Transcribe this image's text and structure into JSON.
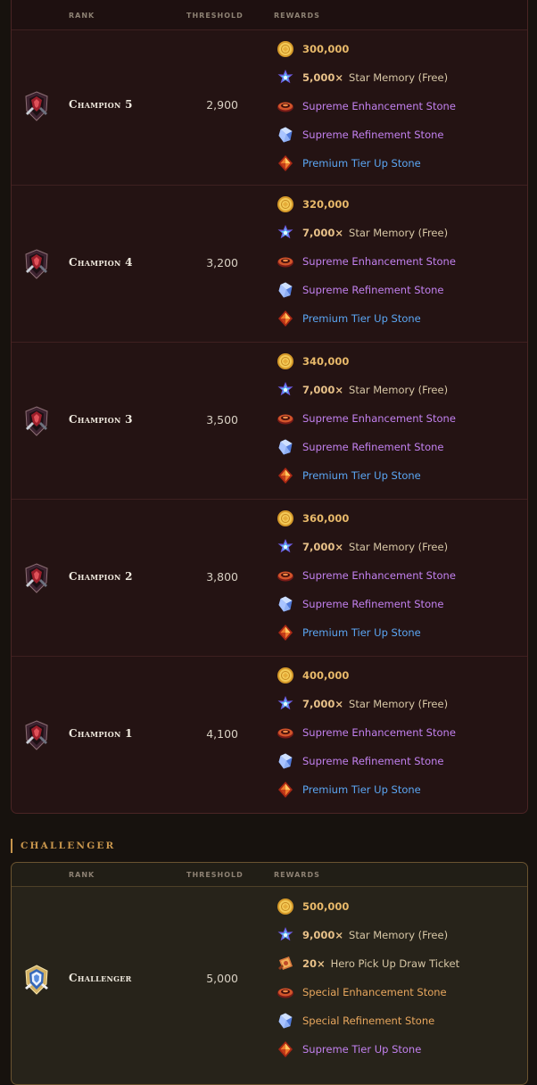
{
  "table_headers": {
    "rank": "RANK",
    "threshold": "THRESHOLD",
    "rewards": "REWARDS"
  },
  "champion_rows": [
    {
      "rank": "Champion 5",
      "threshold": "2,900",
      "gold": "300,000",
      "star_qty": "5,000×",
      "star_label": "Star Memory (Free)",
      "enhance": "Supreme Enhancement Stone",
      "refine": "Supreme Refinement Stone",
      "tier": "Premium Tier Up Stone"
    },
    {
      "rank": "Champion 4",
      "threshold": "3,200",
      "gold": "320,000",
      "star_qty": "7,000×",
      "star_label": "Star Memory (Free)",
      "enhance": "Supreme Enhancement Stone",
      "refine": "Supreme Refinement Stone",
      "tier": "Premium Tier Up Stone"
    },
    {
      "rank": "Champion 3",
      "threshold": "3,500",
      "gold": "340,000",
      "star_qty": "7,000×",
      "star_label": "Star Memory (Free)",
      "enhance": "Supreme Enhancement Stone",
      "refine": "Supreme Refinement Stone",
      "tier": "Premium Tier Up Stone"
    },
    {
      "rank": "Champion 2",
      "threshold": "3,800",
      "gold": "360,000",
      "star_qty": "7,000×",
      "star_label": "Star Memory (Free)",
      "enhance": "Supreme Enhancement Stone",
      "refine": "Supreme Refinement Stone",
      "tier": "Premium Tier Up Stone"
    },
    {
      "rank": "Champion 1",
      "threshold": "4,100",
      "gold": "400,000",
      "star_qty": "7,000×",
      "star_label": "Star Memory (Free)",
      "enhance": "Supreme Enhancement Stone",
      "refine": "Supreme Refinement Stone",
      "tier": "Premium Tier Up Stone"
    }
  ],
  "challenger_section": {
    "title": "CHALLENGER",
    "row": {
      "rank": "Challenger",
      "threshold": "5,000",
      "gold": "500,000",
      "star_qty": "9,000×",
      "star_label": "Star Memory (Free)",
      "ticket_qty": "20×",
      "ticket_label": "Hero Pick Up Draw Ticket",
      "enhance": "Special Enhancement Stone",
      "refine": "Special Refinement Stone",
      "tier": "Supreme Tier Up Stone"
    }
  },
  "icons": {
    "champion_badge": "champion-crest-icon",
    "challenger_badge": "challenger-crest-icon",
    "gold": "gold-coin-icon",
    "star": "star-memory-icon",
    "enhance": "enhancement-stone-icon",
    "refine": "refinement-stone-icon",
    "tier": "tier-up-stone-icon",
    "ticket": "draw-ticket-icon"
  },
  "colors": {
    "gold_text": "#e8b96a",
    "purple_text": "#c281ef",
    "blue_text": "#5ba6f3",
    "orange_text": "#e8a75e",
    "section_accent": "#c7954c"
  }
}
